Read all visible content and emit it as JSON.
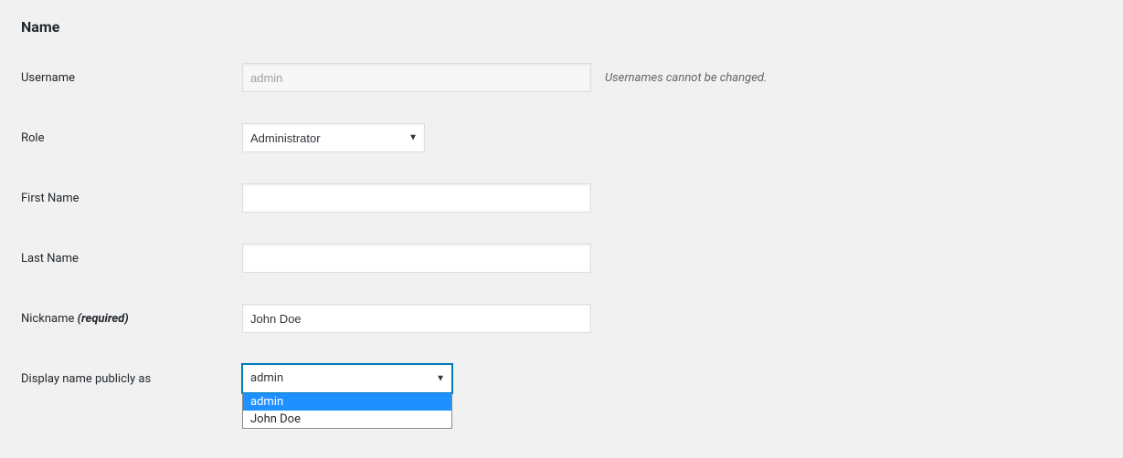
{
  "section": {
    "title": "Name"
  },
  "fields": {
    "username": {
      "label": "Username",
      "value": "admin",
      "description": "Usernames cannot be changed."
    },
    "role": {
      "label": "Role",
      "value": "Administrator"
    },
    "first_name": {
      "label": "First Name",
      "value": ""
    },
    "last_name": {
      "label": "Last Name",
      "value": ""
    },
    "nickname": {
      "label": "Nickname",
      "required_text": "(required)",
      "value": "John Doe"
    },
    "display_name": {
      "label": "Display name publicly as",
      "value": "admin",
      "options": [
        "admin",
        "John Doe"
      ],
      "highlighted_index": 0
    }
  }
}
